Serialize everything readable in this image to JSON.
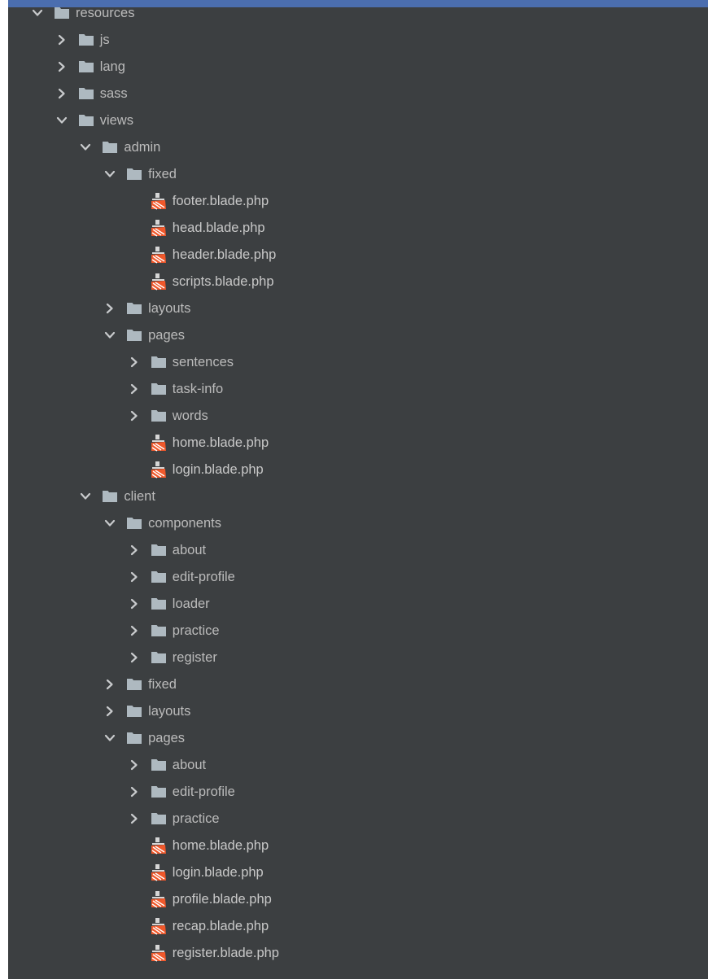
{
  "project_tree": {
    "rows": [
      {
        "label": "resources",
        "kind": "folder",
        "depth": 0,
        "expanded": true
      },
      {
        "label": "js",
        "kind": "folder",
        "depth": 1,
        "expanded": false
      },
      {
        "label": "lang",
        "kind": "folder",
        "depth": 1,
        "expanded": false
      },
      {
        "label": "sass",
        "kind": "folder",
        "depth": 1,
        "expanded": false
      },
      {
        "label": "views",
        "kind": "folder",
        "depth": 1,
        "expanded": true
      },
      {
        "label": "admin",
        "kind": "folder",
        "depth": 2,
        "expanded": true
      },
      {
        "label": "fixed",
        "kind": "folder",
        "depth": 3,
        "expanded": true
      },
      {
        "label": "footer.blade.php",
        "kind": "file",
        "depth": 4
      },
      {
        "label": "head.blade.php",
        "kind": "file",
        "depth": 4
      },
      {
        "label": "header.blade.php",
        "kind": "file",
        "depth": 4
      },
      {
        "label": "scripts.blade.php",
        "kind": "file",
        "depth": 4
      },
      {
        "label": "layouts",
        "kind": "folder",
        "depth": 3,
        "expanded": false
      },
      {
        "label": "pages",
        "kind": "folder",
        "depth": 3,
        "expanded": true
      },
      {
        "label": "sentences",
        "kind": "folder",
        "depth": 4,
        "expanded": false
      },
      {
        "label": "task-info",
        "kind": "folder",
        "depth": 4,
        "expanded": false
      },
      {
        "label": "words",
        "kind": "folder",
        "depth": 4,
        "expanded": false
      },
      {
        "label": "home.blade.php",
        "kind": "file",
        "depth": 4
      },
      {
        "label": "login.blade.php",
        "kind": "file",
        "depth": 4
      },
      {
        "label": "client",
        "kind": "folder",
        "depth": 2,
        "expanded": true
      },
      {
        "label": "components",
        "kind": "folder",
        "depth": 3,
        "expanded": true
      },
      {
        "label": "about",
        "kind": "folder",
        "depth": 4,
        "expanded": false
      },
      {
        "label": "edit-profile",
        "kind": "folder",
        "depth": 4,
        "expanded": false
      },
      {
        "label": "loader",
        "kind": "folder",
        "depth": 4,
        "expanded": false
      },
      {
        "label": "practice",
        "kind": "folder",
        "depth": 4,
        "expanded": false
      },
      {
        "label": "register",
        "kind": "folder",
        "depth": 4,
        "expanded": false
      },
      {
        "label": "fixed",
        "kind": "folder",
        "depth": 3,
        "expanded": false
      },
      {
        "label": "layouts",
        "kind": "folder",
        "depth": 3,
        "expanded": false
      },
      {
        "label": "pages",
        "kind": "folder",
        "depth": 3,
        "expanded": true
      },
      {
        "label": "about",
        "kind": "folder",
        "depth": 4,
        "expanded": false
      },
      {
        "label": "edit-profile",
        "kind": "folder",
        "depth": 4,
        "expanded": false
      },
      {
        "label": "practice",
        "kind": "folder",
        "depth": 4,
        "expanded": false
      },
      {
        "label": "home.blade.php",
        "kind": "file",
        "depth": 4
      },
      {
        "label": "login.blade.php",
        "kind": "file",
        "depth": 4
      },
      {
        "label": "profile.blade.php",
        "kind": "file",
        "depth": 4
      },
      {
        "label": "recap.blade.php",
        "kind": "file",
        "depth": 4
      },
      {
        "label": "register.blade.php",
        "kind": "file",
        "depth": 4
      }
    ]
  },
  "icons": {
    "folder": "folder-icon",
    "blade_file": "laravel-blade-file-icon",
    "collapsed": "chevron-right-icon",
    "expanded": "chevron-down-icon"
  },
  "colors": {
    "background": "#3c3f41",
    "text": "#bbbbbb",
    "folder_icon": "#aeb9c0",
    "blade_icon": "#f0582b",
    "chevron": "#c8cacc",
    "selection_accent": "#4b6eaf"
  }
}
